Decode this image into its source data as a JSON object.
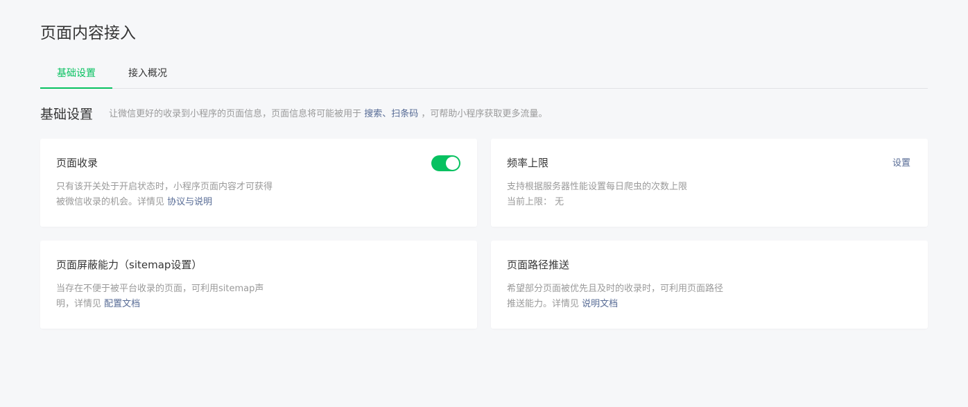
{
  "page": {
    "title": "页面内容接入"
  },
  "tabs": [
    {
      "label": "基础设置",
      "active": true
    },
    {
      "label": "接入概况",
      "active": false
    }
  ],
  "section": {
    "title": "基础设置",
    "desc_before": "让微信更好的收录到小程序的页面信息，页面信息将可能被用于",
    "desc_link": "搜索、扫条码",
    "desc_after": "，可帮助小程序获取更多流量。"
  },
  "cards": [
    {
      "title": "页面收录",
      "desc_line1": "只有该开关处于开启状态时，小程序页面内容才可获得",
      "desc_line2": "被微信收录的机会。详情见",
      "link": "协议与说明",
      "switch_on": true
    },
    {
      "title": "频率上限",
      "action": "设置",
      "desc_line1": "支持根据服务器性能设置每日爬虫的次数上限",
      "limit_label": "当前上限：",
      "limit_value": "无"
    },
    {
      "title": "页面屏蔽能力（sitemap设置）",
      "desc_line1": "当存在不便于被平台收录的页面，可利用sitemap声",
      "desc_line2": "明，详情见",
      "link": "配置文档"
    },
    {
      "title": "页面路径推送",
      "desc_line1": "希望部分页面被优先且及时的收录时，可利用页面路径",
      "desc_line2": "推送能力。详情见",
      "link": "说明文档"
    }
  ],
  "colors": {
    "accent": "#07c160",
    "link": "#576b95",
    "muted": "#9a9a9a",
    "background": "#f6f7f9"
  }
}
